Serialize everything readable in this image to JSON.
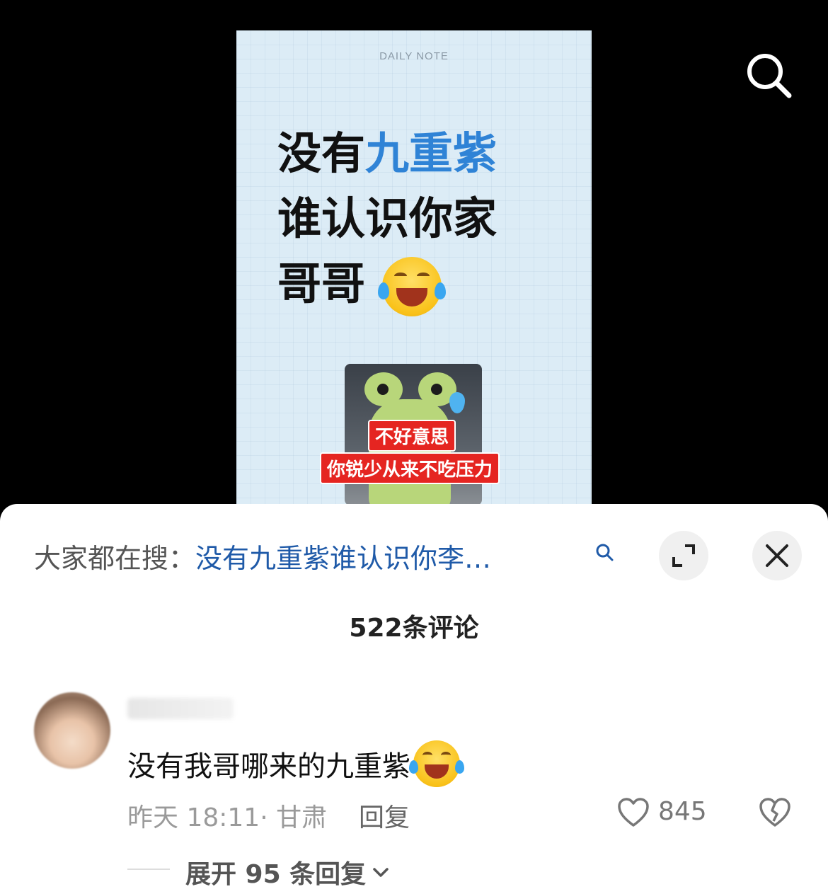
{
  "preview": {
    "note_label": "DAILY NOTE",
    "line1_a": "没有",
    "line1_b": "九重紫",
    "line2": "谁认识你家",
    "line3": "哥哥",
    "caption1": "不好意思",
    "caption2": "你锐少从来不吃压力"
  },
  "sheet": {
    "search_prefix": "大家都在搜：",
    "search_query": "没有九重紫谁认识你李…",
    "comment_count": "522条评论",
    "comment": {
      "text": "没有我哥哪来的九重紫",
      "meta": "昨天 18:11· 甘肃",
      "reply_label": "回复",
      "like_count": "845"
    },
    "expand_replies": "展开 95 条回复"
  },
  "icons": {
    "top_search": "search-icon",
    "expand": "expand-icon",
    "close": "close-icon",
    "like": "heart-icon",
    "dislike": "broken-heart-icon"
  },
  "colors": {
    "highlight_blue": "#2f83d6",
    "search_link": "#1f5aa8",
    "caption_red": "#e52521"
  }
}
